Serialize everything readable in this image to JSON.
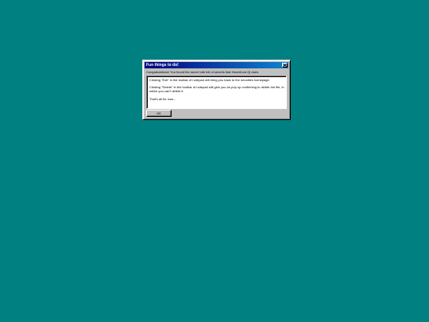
{
  "dialog": {
    "title": "Fun things to do!",
    "intro": "Congratulations! You found the secret site full of secrets that Haverfund Qt does",
    "paragraphs": [
      "Clicking \"Exit\" in the toolbar of notepad will bring you back to the neocities homepage.",
      "Clicking \"Delete\" in the toolbar of notepad will give you an pop up confirming to delete the file, in which you can't delete it.",
      "That's all for now..."
    ],
    "ok_label": "OK"
  },
  "colors": {
    "desktop": "#008080",
    "titlebar_start": "#000080",
    "titlebar_end": "#1084d0",
    "window": "#c0c0c0"
  },
  "icons": {
    "close": "close-icon"
  }
}
